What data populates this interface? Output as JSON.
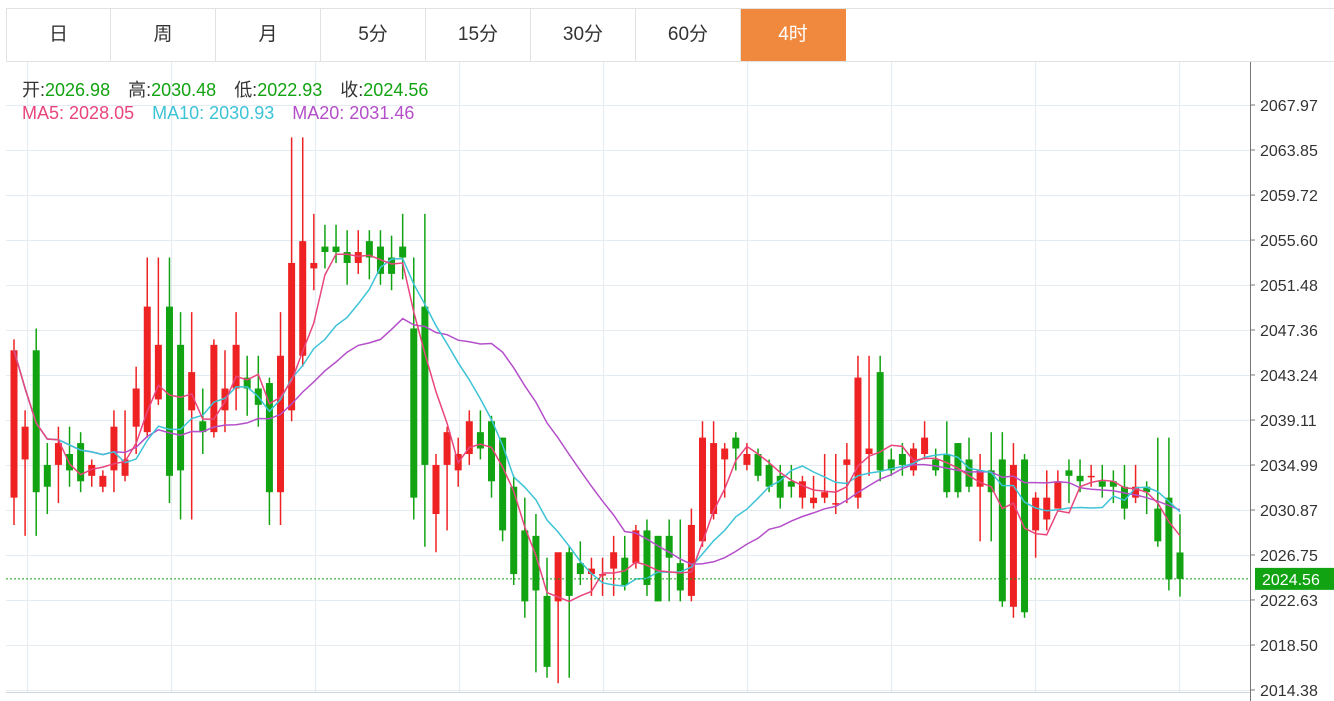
{
  "tabs": [
    {
      "label": "日",
      "active": false
    },
    {
      "label": "周",
      "active": false
    },
    {
      "label": "月",
      "active": false
    },
    {
      "label": "5分",
      "active": false
    },
    {
      "label": "15分",
      "active": false
    },
    {
      "label": "30分",
      "active": false
    },
    {
      "label": "60分",
      "active": false
    },
    {
      "label": "4时",
      "active": true
    }
  ],
  "ohlc": {
    "open_label": "开:",
    "open": "2026.98",
    "high_label": "高:",
    "high": "2030.48",
    "low_label": "低:",
    "low": "2022.93",
    "close_label": "收:",
    "close": "2024.56"
  },
  "ma": {
    "ma5_label": "MA5:",
    "ma5": "2028.05",
    "ma10_label": "MA10:",
    "ma10": "2030.93",
    "ma20_label": "MA20:",
    "ma20": "2031.46"
  },
  "colors": {
    "up": "#ee2222",
    "down": "#12a312",
    "ma5": "#e8457c",
    "ma10": "#3cc3d6",
    "ma20": "#b44fc9",
    "grid": "#e4ecf2",
    "accent": "#f0883e",
    "price_text": "#12a312"
  },
  "chart_data": {
    "type": "candlestick",
    "timeframe": "4时",
    "ylim": [
      2014.38,
      2067.97
    ],
    "yticks": [
      "2067.97",
      "2063.85",
      "2059.72",
      "2055.60",
      "2051.48",
      "2047.36",
      "2043.24",
      "2039.11",
      "2034.99",
      "2030.87",
      "2026.75",
      "2022.63",
      "2018.50",
      "2014.38"
    ],
    "last_price": "2024.56",
    "candles": [
      [
        2032.0,
        2046.5,
        2029.5,
        2045.5
      ],
      [
        2035.5,
        2040.0,
        2028.5,
        2038.5
      ],
      [
        2045.5,
        2047.5,
        2028.5,
        2032.5
      ],
      [
        2035.0,
        2037.0,
        2030.5,
        2033.0
      ],
      [
        2035.0,
        2038.5,
        2031.5,
        2037.0
      ],
      [
        2036.0,
        2038.5,
        2033.0,
        2034.5
      ],
      [
        2037.0,
        2038.0,
        2032.5,
        2033.5
      ],
      [
        2034.0,
        2035.5,
        2033.0,
        2035.0
      ],
      [
        2033.0,
        2034.5,
        2032.5,
        2034.0
      ],
      [
        2034.5,
        2040.0,
        2032.5,
        2038.5
      ],
      [
        2034.0,
        2040.0,
        2033.5,
        2035.5
      ],
      [
        2038.5,
        2044.0,
        2036.0,
        2042.0
      ],
      [
        2038.0,
        2054.0,
        2037.5,
        2049.5
      ],
      [
        2041.0,
        2054.0,
        2040.5,
        2046.0
      ],
      [
        2049.5,
        2054.0,
        2031.5,
        2034.0
      ],
      [
        2046.0,
        2049.0,
        2030.0,
        2034.5
      ],
      [
        2040.0,
        2049.0,
        2030.0,
        2043.5
      ],
      [
        2039.0,
        2042.0,
        2036.0,
        2038.0
      ],
      [
        2038.0,
        2046.5,
        2037.5,
        2046.0
      ],
      [
        2040.0,
        2045.5,
        2038.0,
        2042.0
      ],
      [
        2042.0,
        2049.0,
        2040.0,
        2046.0
      ],
      [
        2043.0,
        2045.0,
        2039.5,
        2042.0
      ],
      [
        2042.0,
        2045.0,
        2038.5,
        2040.5
      ],
      [
        2042.5,
        2043.0,
        2029.5,
        2032.5
      ],
      [
        2032.5,
        2049.0,
        2029.5,
        2045.0
      ],
      [
        2040.0,
        2065.0,
        2039.0,
        2053.5
      ],
      [
        2045.0,
        2065.0,
        2044.0,
        2055.5
      ],
      [
        2053.0,
        2058.0,
        2051.0,
        2053.5
      ],
      [
        2055.0,
        2057.0,
        2053.0,
        2054.5
      ],
      [
        2055.0,
        2057.0,
        2053.5,
        2054.5
      ],
      [
        2054.5,
        2056.5,
        2051.5,
        2053.5
      ],
      [
        2053.5,
        2056.5,
        2052.5,
        2054.5
      ],
      [
        2055.5,
        2056.5,
        2052.0,
        2054.0
      ],
      [
        2055.0,
        2056.5,
        2051.5,
        2052.5
      ],
      [
        2054.0,
        2056.0,
        2051.0,
        2052.5
      ],
      [
        2055.0,
        2058.0,
        2052.0,
        2054.0
      ],
      [
        2047.5,
        2054.0,
        2030.0,
        2032.0
      ],
      [
        2049.5,
        2058.0,
        2027.5,
        2035.0
      ],
      [
        2030.5,
        2036.0,
        2027.0,
        2035.0
      ],
      [
        2035.0,
        2038.5,
        2029.0,
        2038.0
      ],
      [
        2034.5,
        2037.5,
        2033.0,
        2036.0
      ],
      [
        2036.0,
        2040.0,
        2035.0,
        2039.0
      ],
      [
        2038.0,
        2040.0,
        2035.5,
        2036.5
      ],
      [
        2039.0,
        2039.5,
        2032.0,
        2033.5
      ],
      [
        2037.5,
        2037.5,
        2028.0,
        2029.0
      ],
      [
        2033.0,
        2034.0,
        2024.0,
        2025.0
      ],
      [
        2029.0,
        2032.0,
        2021.0,
        2022.5
      ],
      [
        2028.5,
        2030.5,
        2016.0,
        2023.5
      ],
      [
        2023.0,
        2026.5,
        2015.5,
        2016.5
      ],
      [
        2022.5,
        2026.0,
        2015.0,
        2027.0
      ],
      [
        2027.0,
        2027.5,
        2015.5,
        2023.0
      ],
      [
        2026.0,
        2028.0,
        2024.0,
        2025.0
      ],
      [
        2025.0,
        2026.5,
        2023.0,
        2025.5
      ],
      [
        2025.0,
        2026.5,
        2023.0,
        2025.0
      ],
      [
        2025.5,
        2028.5,
        2023.0,
        2027.0
      ],
      [
        2026.5,
        2028.5,
        2023.5,
        2024.0
      ],
      [
        2026.0,
        2029.5,
        2025.5,
        2029.0
      ],
      [
        2029.0,
        2030.0,
        2023.0,
        2024.0
      ],
      [
        2028.5,
        2028.5,
        2022.5,
        2022.5
      ],
      [
        2028.5,
        2030.0,
        2022.5,
        2026.5
      ],
      [
        2026.0,
        2030.0,
        2022.5,
        2023.5
      ],
      [
        2023.0,
        2031.0,
        2022.5,
        2029.5
      ],
      [
        2028.0,
        2039.0,
        2027.5,
        2037.5
      ],
      [
        2030.5,
        2039.0,
        2030.0,
        2037.0
      ],
      [
        2035.5,
        2037.0,
        2032.0,
        2036.5
      ],
      [
        2037.5,
        2038.0,
        2034.5,
        2036.5
      ],
      [
        2035.0,
        2037.0,
        2034.5,
        2036.0
      ],
      [
        2036.0,
        2036.5,
        2033.5,
        2034.0
      ],
      [
        2035.0,
        2035.5,
        2032.5,
        2033.0
      ],
      [
        2034.0,
        2035.0,
        2031.0,
        2032.0
      ],
      [
        2033.5,
        2035.0,
        2032.0,
        2033.0
      ],
      [
        2032.0,
        2034.0,
        2031.0,
        2033.5
      ],
      [
        2031.5,
        2034.0,
        2031.0,
        2032.0
      ],
      [
        2032.0,
        2036.0,
        2031.5,
        2032.5
      ],
      [
        2031.5,
        2036.0,
        2030.5,
        2031.5
      ],
      [
        2035.0,
        2037.0,
        2031.5,
        2035.5
      ],
      [
        2032.0,
        2045.0,
        2031.0,
        2043.0
      ],
      [
        2036.0,
        2045.0,
        2034.0,
        2036.5
      ],
      [
        2043.5,
        2045.0,
        2033.5,
        2034.5
      ],
      [
        2035.5,
        2036.5,
        2034.0,
        2034.5
      ],
      [
        2036.0,
        2037.0,
        2034.0,
        2035.0
      ],
      [
        2034.5,
        2037.0,
        2034.0,
        2036.5
      ],
      [
        2036.0,
        2039.0,
        2035.5,
        2037.5
      ],
      [
        2035.5,
        2036.5,
        2034.0,
        2034.5
      ],
      [
        2036.0,
        2039.0,
        2032.0,
        2032.5
      ],
      [
        2037.0,
        2037.0,
        2032.0,
        2032.5
      ],
      [
        2035.5,
        2037.5,
        2032.5,
        2033.0
      ],
      [
        2033.0,
        2036.0,
        2028.0,
        2034.5
      ],
      [
        2034.5,
        2038.0,
        2028.0,
        2032.5
      ],
      [
        2035.5,
        2038.0,
        2022.0,
        2022.5
      ],
      [
        2022.0,
        2037.0,
        2021.0,
        2035.0
      ],
      [
        2035.5,
        2036.0,
        2021.0,
        2021.5
      ],
      [
        2029.0,
        2032.5,
        2026.5,
        2032.0
      ],
      [
        2030.0,
        2034.5,
        2029.0,
        2032.0
      ],
      [
        2031.0,
        2034.5,
        2031.0,
        2033.5
      ],
      [
        2034.5,
        2035.5,
        2031.5,
        2034.0
      ],
      [
        2034.0,
        2035.5,
        2032.5,
        2033.5
      ],
      [
        2034.0,
        2035.0,
        2033.0,
        2034.0
      ],
      [
        2033.5,
        2035.0,
        2032.0,
        2033.0
      ],
      [
        2033.5,
        2034.5,
        2031.5,
        2033.0
      ],
      [
        2033.0,
        2035.0,
        2030.0,
        2031.0
      ],
      [
        2032.0,
        2035.0,
        2031.5,
        2033.0
      ],
      [
        2033.0,
        2033.5,
        2030.5,
        2032.5
      ],
      [
        2031.0,
        2037.5,
        2027.5,
        2028.0
      ],
      [
        2032.0,
        2037.5,
        2023.5,
        2024.5
      ],
      [
        2026.98,
        2030.48,
        2022.93,
        2024.56
      ]
    ]
  }
}
